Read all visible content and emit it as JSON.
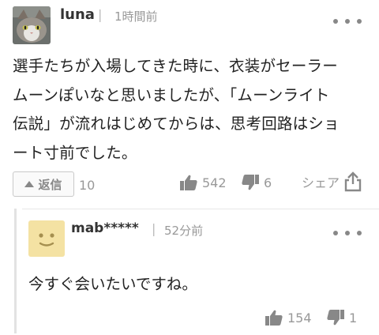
{
  "comment": {
    "username": "luna",
    "separator": "|",
    "time": "1時間前",
    "body_lines": [
      "選手たちが入場してきた時に、衣装がセーラー",
      "ムーンぽいなと思いましたが、「ムーンライト",
      "伝説」が流れはじめてからは、思考回路はショ",
      "ート寸前でした。"
    ],
    "reply_label": "返信",
    "reply_count": "10",
    "likes": "542",
    "dislikes": "6",
    "share_label": "シェア"
  },
  "reply": {
    "username": "mab*****",
    "separator": "|",
    "time": "52分前",
    "body": "今すぐ会いたいですね。",
    "likes": "154",
    "dislikes": "1"
  },
  "icons": {
    "avatar_user": "cat-photo-avatar",
    "avatar_reply": "smiley-face-avatar",
    "more": "more-dots-icon",
    "reply": "triangle-up-icon",
    "like": "thumbs-up-icon",
    "dislike": "thumbs-down-icon",
    "share": "share-icon"
  },
  "colors": {
    "text": "#222222",
    "muted": "#999999",
    "icon": "#888888",
    "reply_avatar_bg": "#f4e2a3",
    "thread_bar": "#e2e2e2"
  }
}
